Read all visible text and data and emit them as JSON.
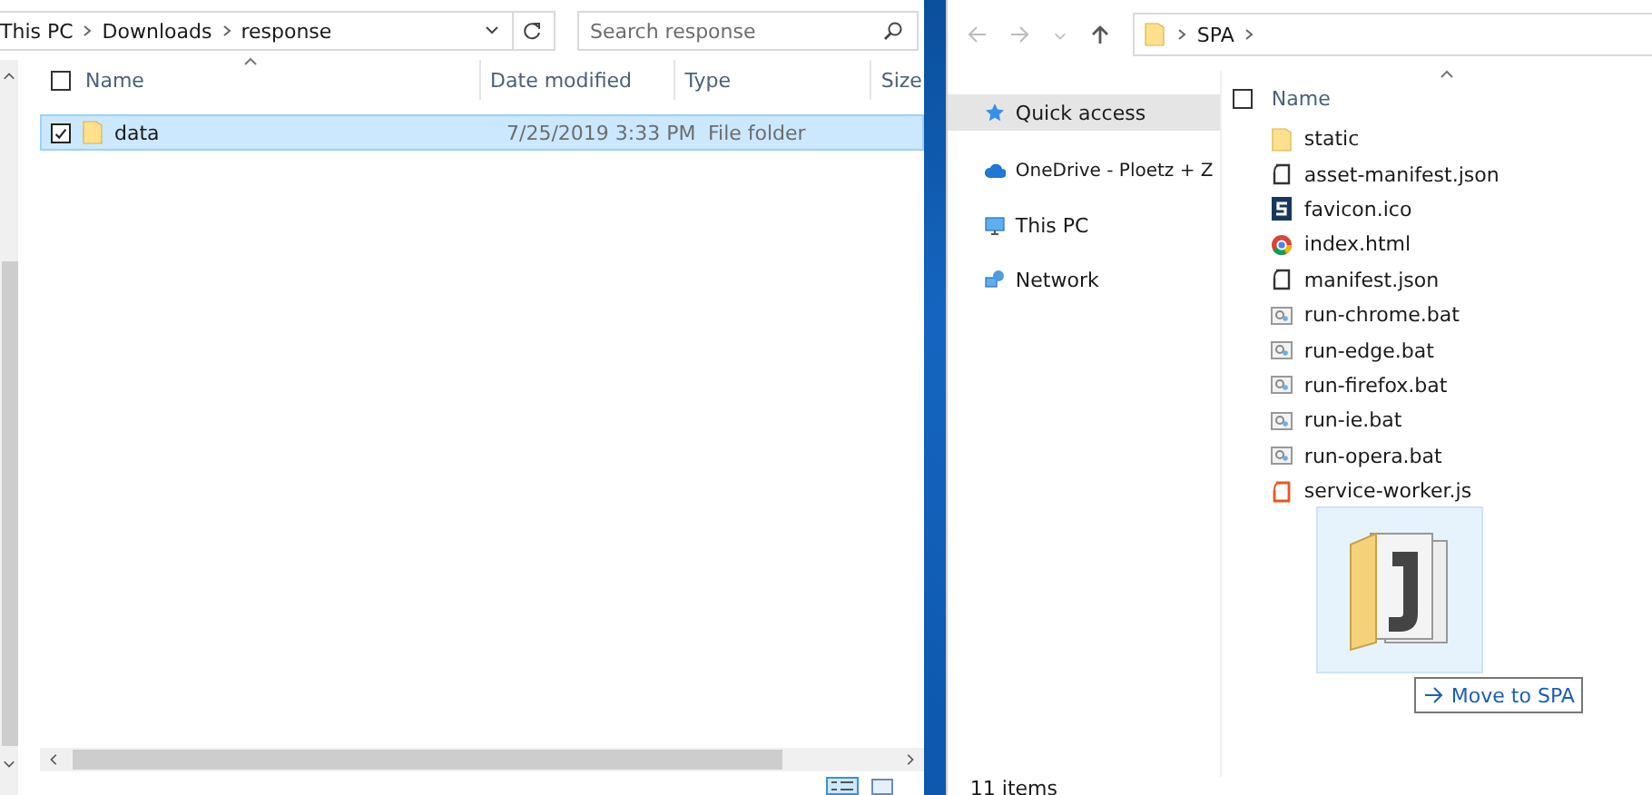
{
  "left_window": {
    "breadcrumb": [
      "This PC",
      "Downloads",
      "response"
    ],
    "search": {
      "placeholder": "Search response"
    },
    "select_all": {
      "checked": false
    },
    "columns": [
      "Name",
      "Date modified",
      "Type",
      "Size"
    ],
    "rows": [
      {
        "name": "data",
        "date": "7/25/2019 3:33 PM",
        "type": "File folder",
        "selected": true,
        "checked": true
      }
    ]
  },
  "right_window": {
    "breadcrumb": [
      "SPA"
    ],
    "nav": [
      {
        "label": "Quick access",
        "kind": "star",
        "selected": true
      },
      {
        "label": "OneDrive - Ploetz + Z",
        "kind": "cloud",
        "selected": false
      },
      {
        "label": "This PC",
        "kind": "pc",
        "selected": false
      },
      {
        "label": "Network",
        "kind": "network",
        "selected": false
      }
    ],
    "select_all": {
      "checked": false
    },
    "column": "Name",
    "files": [
      {
        "name": "static",
        "kind": "folder"
      },
      {
        "name": "asset-manifest.json",
        "kind": "json"
      },
      {
        "name": "favicon.ico",
        "kind": "favicon"
      },
      {
        "name": "index.html",
        "kind": "chrome"
      },
      {
        "name": "manifest.json",
        "kind": "json"
      },
      {
        "name": "run-chrome.bat",
        "kind": "bat"
      },
      {
        "name": "run-edge.bat",
        "kind": "bat"
      },
      {
        "name": "run-firefox.bat",
        "kind": "bat"
      },
      {
        "name": "run-ie.bat",
        "kind": "bat"
      },
      {
        "name": "run-opera.bat",
        "kind": "bat"
      },
      {
        "name": "service-worker.js",
        "kind": "js"
      }
    ],
    "status": "11 items"
  },
  "drag": {
    "tooltip": "Move to SPA"
  }
}
